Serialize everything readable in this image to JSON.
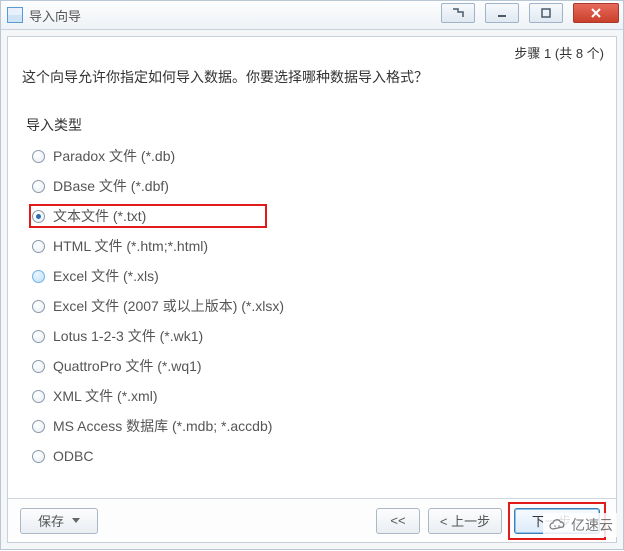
{
  "window": {
    "title": "导入向导"
  },
  "step_label": "步骤 1 (共 8 个)",
  "prompt": "这个向导允许你指定如何导入数据。你要选择哪种数据导入格式？",
  "section_title": "导入类型",
  "options": [
    {
      "label": "Paradox 文件 (*.db)",
      "selected": false,
      "excel_style": false,
      "highlight": false
    },
    {
      "label": "DBase 文件 (*.dbf)",
      "selected": false,
      "excel_style": false,
      "highlight": false
    },
    {
      "label": "文本文件 (*.txt)",
      "selected": true,
      "excel_style": false,
      "highlight": true
    },
    {
      "label": "HTML 文件 (*.htm;*.html)",
      "selected": false,
      "excel_style": false,
      "highlight": false
    },
    {
      "label": "Excel 文件 (*.xls)",
      "selected": false,
      "excel_style": true,
      "highlight": false
    },
    {
      "label": "Excel 文件 (2007 或以上版本) (*.xlsx)",
      "selected": false,
      "excel_style": false,
      "highlight": false
    },
    {
      "label": "Lotus 1-2-3 文件 (*.wk1)",
      "selected": false,
      "excel_style": false,
      "highlight": false
    },
    {
      "label": "QuattroPro 文件 (*.wq1)",
      "selected": false,
      "excel_style": false,
      "highlight": false
    },
    {
      "label": "XML 文件 (*.xml)",
      "selected": false,
      "excel_style": false,
      "highlight": false
    },
    {
      "label": "MS Access 数据库 (*.mdb; *.accdb)",
      "selected": false,
      "excel_style": false,
      "highlight": false
    },
    {
      "label": "ODBC",
      "selected": false,
      "excel_style": false,
      "highlight": false
    }
  ],
  "buttons": {
    "save": "保存",
    "first": "<<",
    "prev": "< 上一步",
    "next": "下一步 >"
  },
  "watermark": "亿速云"
}
